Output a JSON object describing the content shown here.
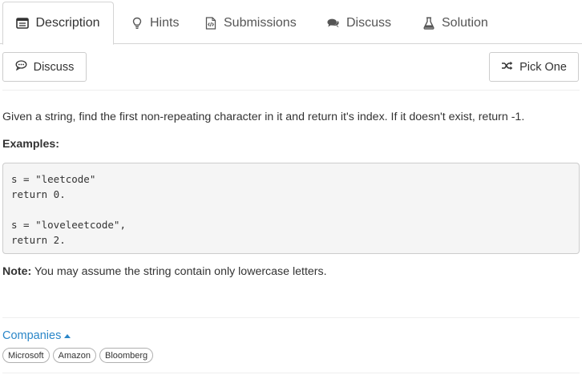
{
  "tabs": [
    {
      "label": "Description",
      "icon": "description-icon"
    },
    {
      "label": "Hints",
      "icon": "lightbulb-icon"
    },
    {
      "label": "Submissions",
      "icon": "code-file-icon"
    },
    {
      "label": "Discuss",
      "icon": "comments-icon"
    },
    {
      "label": "Solution",
      "icon": "flask-icon"
    }
  ],
  "actions": {
    "discuss_label": "Discuss",
    "pick_one_label": "Pick One"
  },
  "problem": {
    "description": "Given a string, find the first non-repeating character in it and return it's index. If it doesn't exist, return -1.",
    "examples_label": "Examples:",
    "code_lines": [
      "s = \"leetcode\"",
      "return 0.",
      "",
      "s = \"loveleetcode\",",
      "return 2."
    ],
    "note_label": "Note:",
    "note_text": " You may assume the string contain only lowercase letters."
  },
  "companies": {
    "label": "Companies",
    "tags": [
      "Microsoft",
      "Amazon",
      "Bloomberg"
    ]
  },
  "colors": {
    "link": "#2a86c8",
    "border": "#d4d4d4",
    "code_bg": "#f5f5f5"
  }
}
